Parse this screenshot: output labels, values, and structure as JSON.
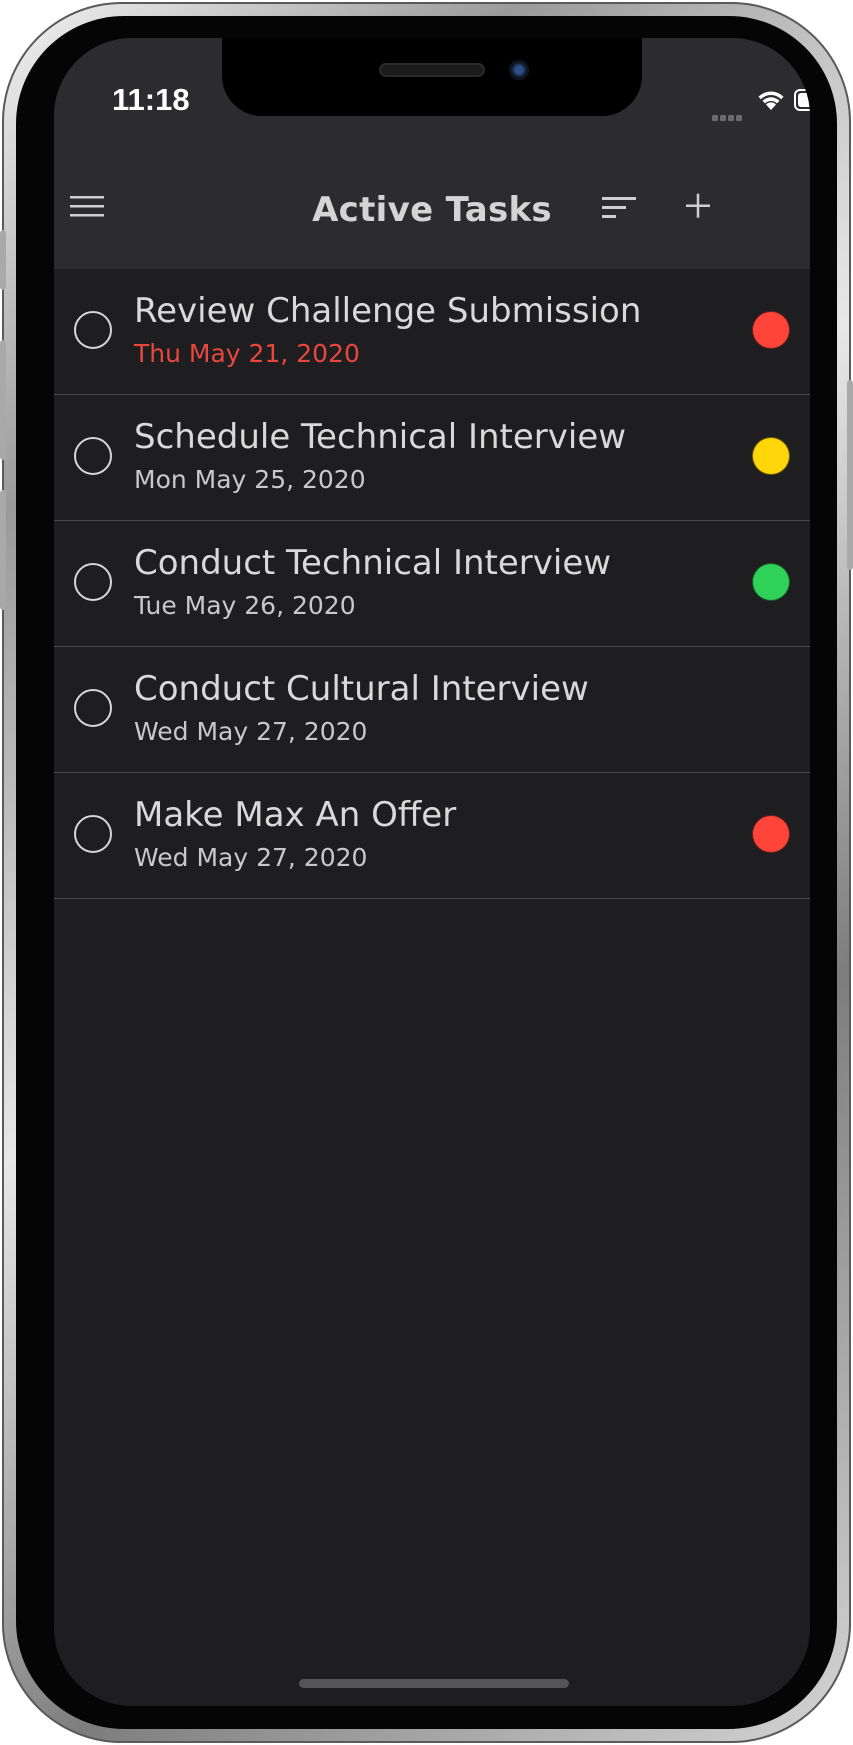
{
  "status_bar": {
    "time": "11:18"
  },
  "nav": {
    "title": "Active Tasks",
    "menu_icon": "hamburger-menu-icon",
    "sort_icon": "sort-icon",
    "add_icon": "plus-icon"
  },
  "tasks": [
    {
      "title": "Review Challenge Submission",
      "date": "Thu May 21, 2020",
      "overdue": true,
      "priority": "high",
      "priority_color": "#ff453a"
    },
    {
      "title": "Schedule Technical Interview",
      "date": "Mon May 25, 2020",
      "overdue": false,
      "priority": "medium",
      "priority_color": "#ffd60a"
    },
    {
      "title": "Conduct Technical Interview",
      "date": "Tue May 26, 2020",
      "overdue": false,
      "priority": "low",
      "priority_color": "#30d158"
    },
    {
      "title": "Conduct Cultural Interview",
      "date": "Wed May 27, 2020",
      "overdue": false,
      "priority": "none",
      "priority_color": ""
    },
    {
      "title": "Make Max An Offer",
      "date": "Wed May 27, 2020",
      "overdue": false,
      "priority": "high",
      "priority_color": "#ff453a"
    }
  ],
  "colors": {
    "background": "#1e1e20",
    "bar": "#2c2c2e",
    "overdue_date": "#e8473e"
  }
}
